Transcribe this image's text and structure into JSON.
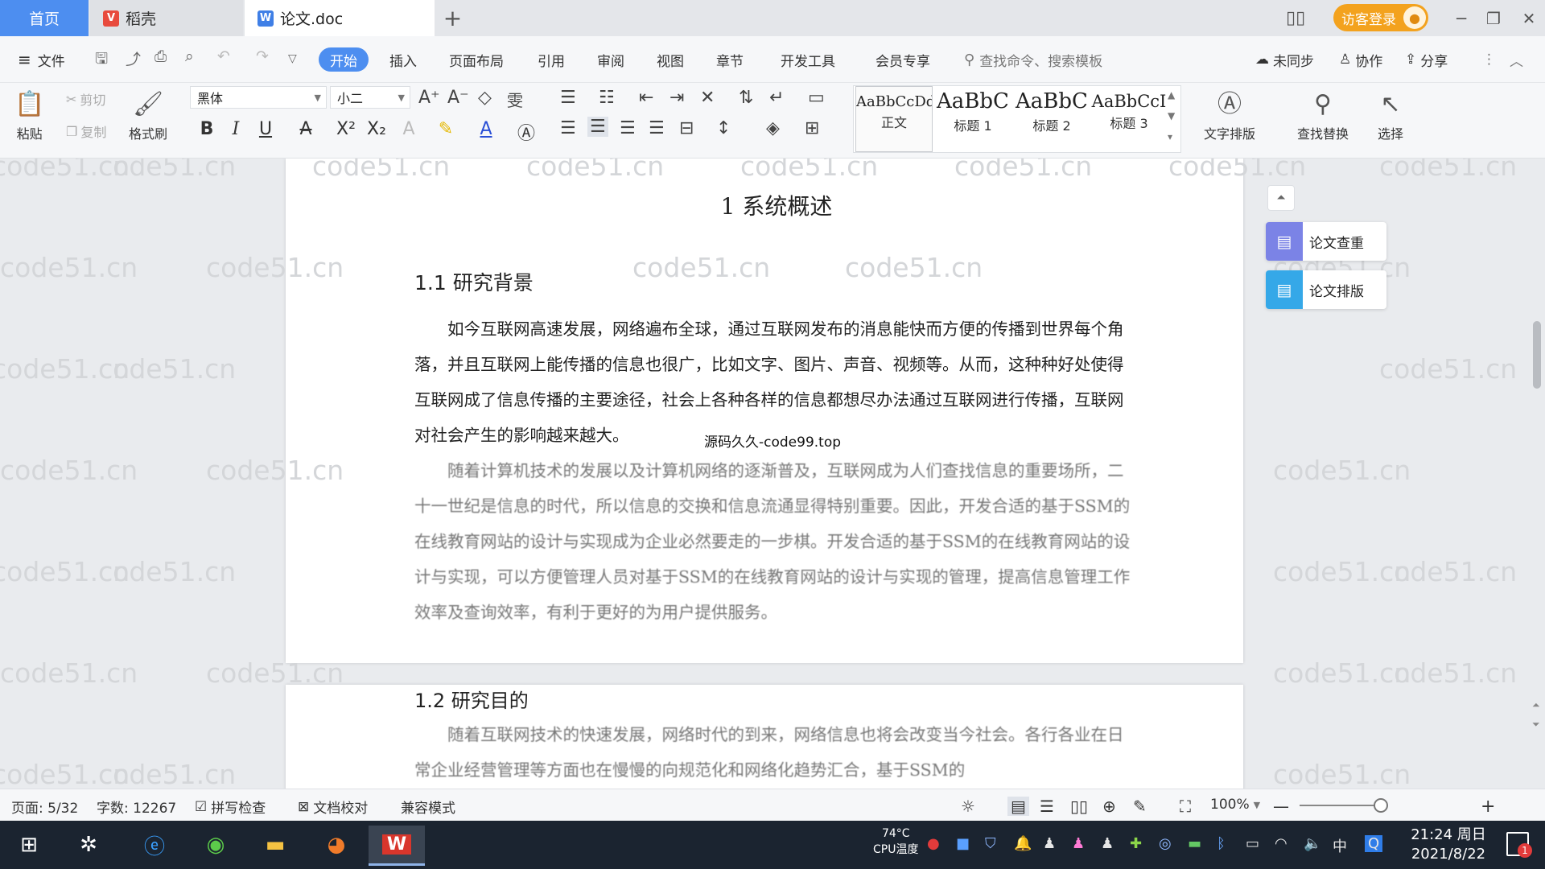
{
  "tabs": {
    "home": "首页",
    "daoke": "稻壳",
    "doc": "论文.doc",
    "new_tab": "+"
  },
  "titlebar": {
    "login": "访客登录",
    "minimize": "─",
    "restore": "❐",
    "close": "✕"
  },
  "menu": {
    "file": "文件",
    "items": [
      "开始",
      "插入",
      "页面布局",
      "引用",
      "审阅",
      "视图",
      "章节",
      "开发工具",
      "会员专享"
    ],
    "search_placeholder": "查找命令、搜索模板",
    "unsynced": "未同步",
    "collab": "协作",
    "share": "分享"
  },
  "ribbon": {
    "paste": "粘贴",
    "cut": "剪切",
    "copy": "复制",
    "format_painter": "格式刷",
    "font_name": "黑体",
    "font_size": "小二",
    "styles": [
      {
        "preview": "AaBbCcDd",
        "label": "正文"
      },
      {
        "preview": "AaBbC",
        "label": "标题 1"
      },
      {
        "preview": "AaBbC",
        "label": "标题 2"
      },
      {
        "preview": "AaBbCcI",
        "label": "标题 3"
      }
    ],
    "text_layout": "文字排版",
    "find_replace": "查找替换",
    "select": "选择"
  },
  "document": {
    "chapter_title": "1 系统概述",
    "section1_title": "1.1  研究背景",
    "para1": "如今互联网高速发展，网络遍布全球，通过互联网发布的消息能快而方便的传播到世界每个角落，并且互联网上能传播的信息也很广，比如文字、图片、声音、视频等。从而，这种种好处使得互联网成了信息传播的主要途径，社会上各种各样的信息都想尽办法通过互联网进行传播，互联网对社会产生的影响越来越大。",
    "para2": "随着计算机技术的发展以及计算机网络的逐渐普及，互联网成为人们查找信息的重要场所，二十一世纪是信息的时代，所以信息的交换和信息流通显得特别重要。因此，开发合适的基于SSM的在线教育网站的设计与实现成为企业必然要走的一步棋。开发合适的基于SSM的在线教育网站的设计与实现，可以方便管理人员对基于SSM的在线教育网站的设计与实现的管理，提高信息管理工作效率及查询效率，有利于更好的为用户提供服务。",
    "overlay_note": "源码久久-code99.top",
    "section2_title": "1.2 研究目的",
    "para3": "随着互联网技术的快速发展，网络时代的到来，网络信息也将会改变当今社会。各行各业在日常企业经营管理等方面也在慢慢的向规范化和网络化趋势汇合，基于SSM的",
    "watermark": "code51.cn"
  },
  "side_panel": {
    "check": "论文查重",
    "layout": "论文排版"
  },
  "status": {
    "page": "页面: 5/32",
    "words": "字数: 12267",
    "spell": "拼写检查",
    "proof": "文档校对",
    "compat": "兼容模式",
    "zoom": "100%"
  },
  "taskbar": {
    "cpu_temp": "74°C",
    "cpu_label": "CPU温度",
    "ime": "中",
    "time": "21:24 周日",
    "date": "2021/8/22",
    "notif_count": "1"
  }
}
